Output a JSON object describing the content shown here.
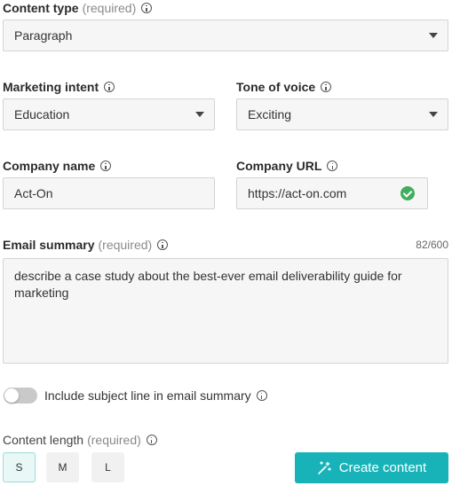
{
  "content_type": {
    "label": "Content type",
    "required_text": "(required)",
    "value": "Paragraph"
  },
  "marketing_intent": {
    "label": "Marketing intent",
    "value": "Education"
  },
  "tone_of_voice": {
    "label": "Tone of voice",
    "value": "Exciting"
  },
  "company_name": {
    "label": "Company name",
    "value": "Act-On"
  },
  "company_url": {
    "label": "Company URL",
    "value": "https://act-on.com",
    "status": "valid"
  },
  "email_summary": {
    "label": "Email summary",
    "required_text": "(required)",
    "counter": "82/600",
    "value": "describe a case study about the best-ever email deliverability guide for marketing"
  },
  "subject_line_toggle": {
    "label": "Include subject line in email summary",
    "on": false
  },
  "content_length": {
    "label": "Content length",
    "required_text": "(required)",
    "options": [
      "S",
      "M",
      "L"
    ],
    "selected": "S"
  },
  "create_button": {
    "label": "Create content"
  },
  "colors": {
    "accent": "#18b3b8",
    "success": "#3fae5f",
    "selected_bg": "#e9f7f7"
  },
  "icons": [
    "info-icon",
    "dropdown-caret-icon",
    "check-circle-icon",
    "magic-wand-icon"
  ]
}
